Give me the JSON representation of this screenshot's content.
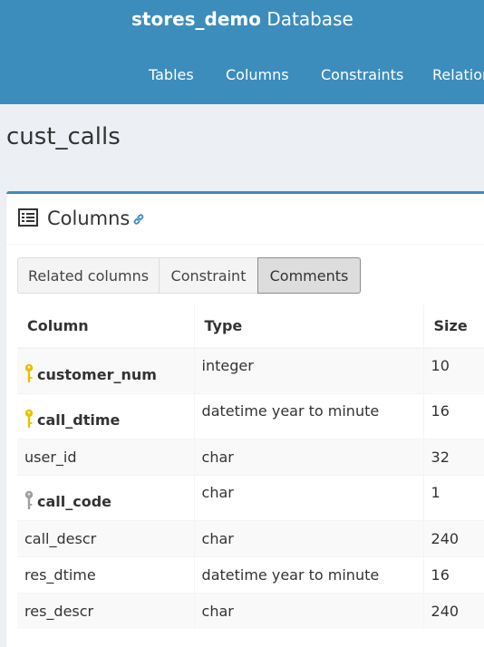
{
  "app": {
    "db_name": "stores_demo",
    "db_suffix": "Database"
  },
  "nav": {
    "items": [
      "Tables",
      "Columns",
      "Constraints",
      "Relation"
    ]
  },
  "page": {
    "title": "cust_calls"
  },
  "box": {
    "title": "Columns",
    "icons": {
      "header": "list-icon",
      "link": "link-icon"
    }
  },
  "tabs": [
    {
      "label": "Related columns",
      "active": false
    },
    {
      "label": "Constraint",
      "active": false
    },
    {
      "label": "Comments",
      "active": true
    }
  ],
  "table": {
    "headers": [
      "Column",
      "Type",
      "Size"
    ],
    "rows": [
      {
        "name": "customer_num",
        "type": "integer",
        "size": "10",
        "key": "primary"
      },
      {
        "name": "call_dtime",
        "type": "datetime year to minute",
        "size": "16",
        "key": "primary"
      },
      {
        "name": "user_id",
        "type": "char",
        "size": "32",
        "key": "none"
      },
      {
        "name": "call_code",
        "type": "char",
        "size": "1",
        "key": "foreign"
      },
      {
        "name": "call_descr",
        "type": "char",
        "size": "240",
        "key": "none"
      },
      {
        "name": "res_dtime",
        "type": "datetime year to minute",
        "size": "16",
        "key": "none"
      },
      {
        "name": "res_descr",
        "type": "char",
        "size": "240",
        "key": "none"
      }
    ]
  },
  "colors": {
    "header_bg": "#3c8dbc",
    "body_bg": "#ecf0f5",
    "primary_key": "#e6c200",
    "foreign_key": "#a0a0a0"
  }
}
